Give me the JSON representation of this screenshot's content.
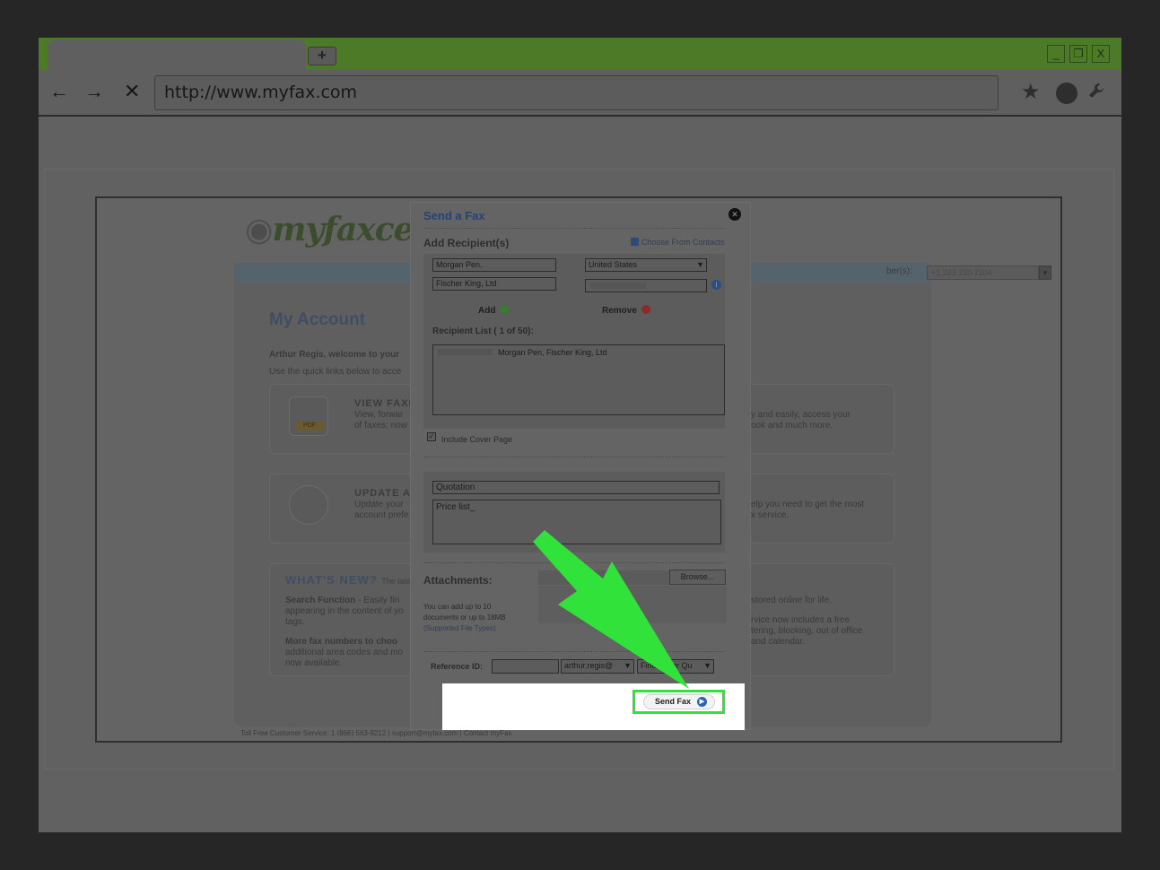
{
  "browser": {
    "new_tab_label": "+",
    "window_controls": [
      "_",
      "❐",
      "X"
    ],
    "url": "http://www.myfax.com",
    "icons": [
      "back-arrow-icon",
      "forward-arrow-icon",
      "stop-icon",
      "star-icon",
      "circle-icon",
      "wrench-icon"
    ],
    "accent_color": "#4c7a27"
  },
  "background_page": {
    "logo": "myfaxce",
    "topbar_label": "ber(s):",
    "topbar_number": "+1 323 210 7104",
    "heading": "My Account",
    "welcome": "Arthur Regis, welcome to your",
    "subtext": "Use the quick links below to acce",
    "card1_title": "VIEW FAXE",
    "card1_line1": "View, forwar",
    "card1_line2": "of faxes; now",
    "card1_badge": "PDF",
    "card2_title": "UPDATE AC",
    "card2_line1": "Update your",
    "card2_line2": "account prefe",
    "right1_line1": "y and easily, access your",
    "right1_line2": "ook and much more.",
    "right2_line1": "elp you need to get the most",
    "right2_line2": "x service.",
    "news_title": "WHAT'S NEW?",
    "news_subtitle": "The late",
    "news1_bold": "Search Function",
    "news1_text": " - Easily fin",
    "news1_line2": "appearing in the content of yo",
    "news1_line3": "tags.",
    "news2_bold": "More fax numbers to choo",
    "news2_line2": "additional area codes and mo",
    "news2_line3": "now available.",
    "right3_line1": "stored online for life.",
    "right3_line2": "rvice now includes a free",
    "right3_line3": "tering, blocking, out of office",
    "right3_line4": "and calendar.",
    "footer": "Toll Free Customer Service: 1 (866) 563-9212 | support@myfax.com | Contact myFax"
  },
  "modal": {
    "title": "Send a Fax",
    "add_recipients": "Add Recipient(s)",
    "choose_contacts": "Choose From Contacts",
    "name_value": "Morgan Pen,",
    "company_value": "Fischer King, Ltd",
    "country_value": "United States",
    "add_label": "Add",
    "remove_label": "Remove",
    "recipient_list_label": "Recipient List ( 1 of 50):",
    "recipient_entry": "Morgan Pen, Fischer King, Ltd",
    "include_cover": "Include Cover Page",
    "subject_value": "Quotation",
    "body_value": "Price list_",
    "attachments_label": "Attachments:",
    "browse_label": "Browse...",
    "note_line1": "You can add up to 10",
    "note_line2": "documents or up to 18MB",
    "note_link": "(Supported File Types)",
    "reference_label": "Reference ID:",
    "sender_value": "arthur.regis@",
    "quality_value": "Fine",
    "quality_tail": "ter Qu",
    "send_label": "Send Fax"
  },
  "highlight_color": "#31e23a"
}
